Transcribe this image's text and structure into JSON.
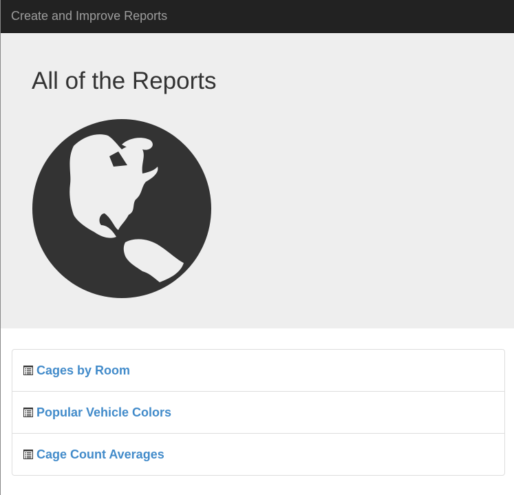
{
  "navbar": {
    "brand": "Create and Improve Reports"
  },
  "jumbotron": {
    "title": "All of the Reports",
    "icon": "globe-icon"
  },
  "reports": [
    {
      "label": "Cages by Room",
      "icon": "list-alt-icon"
    },
    {
      "label": "Popular Vehicle Colors",
      "icon": "list-alt-icon"
    },
    {
      "label": "Cage Count Averages",
      "icon": "list-alt-icon"
    }
  ],
  "colors": {
    "navbar": "#222222",
    "link": "#428bca",
    "jumbotron": "#eeeeee"
  }
}
